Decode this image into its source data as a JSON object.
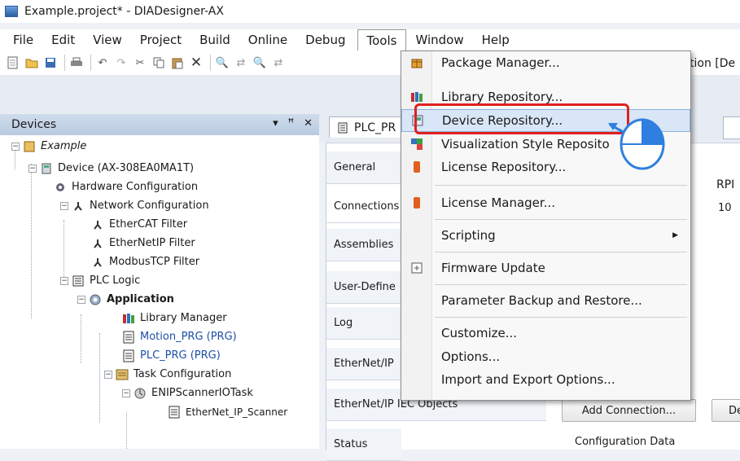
{
  "window": {
    "title": "Example.project* - DIADesigner-AX"
  },
  "menubar": {
    "items": [
      "File",
      "Edit",
      "View",
      "Project",
      "Build",
      "Online",
      "Debug",
      "Tools",
      "Window",
      "Help"
    ]
  },
  "toolbar": {
    "right_text": "tion [De"
  },
  "devices_panel": {
    "title": "Devices",
    "controls": {
      "dropdown": "▾",
      "pin": "ꟸ",
      "close": "✕"
    },
    "tree": [
      {
        "label": "Example"
      },
      {
        "label": "Device (AX-308EA0MA1T)"
      },
      {
        "label": "Hardware Configuration"
      },
      {
        "label": "Network Configuration"
      },
      {
        "label": "EtherCAT Filter"
      },
      {
        "label": "EtherNetIP Filter"
      },
      {
        "label": "ModbusTCP Filter"
      },
      {
        "label": "PLC Logic"
      },
      {
        "label": "Application"
      },
      {
        "label": "Library Manager"
      },
      {
        "label": "Motion_PRG (PRG)"
      },
      {
        "label": "PLC_PRG (PRG)"
      },
      {
        "label": "Task Configuration"
      },
      {
        "label": "ENIPScannerIOTask"
      },
      {
        "label": "EtherNet_IP_Scanner"
      }
    ]
  },
  "editor": {
    "tab_label": "PLC_PR",
    "side_tabs": [
      "General",
      "Connections",
      "Assemblies",
      "User-Define",
      "Log",
      "EtherNet/IP",
      "EtherNet/IP IEC Objects",
      "Status"
    ],
    "rpi_header": "RPI",
    "rpi_value": "10",
    "add_connection_button": "Add Connection...",
    "second_button": "De",
    "config_data_label": "Configuration Data"
  },
  "tools_menu": {
    "items": [
      {
        "label": "Package Manager...",
        "icon": "package-icon"
      },
      {
        "label": "Library Repository...",
        "icon": "books-icon"
      },
      {
        "label": "Device Repository...",
        "icon": "device-repo-icon",
        "highlighted": true
      },
      {
        "label": "Visualization Style Reposito",
        "icon": "vis-style-icon"
      },
      {
        "label": "License Repository...",
        "icon": "license-icon"
      },
      {
        "label": "License Manager...",
        "icon": "license-icon"
      },
      {
        "label": "Scripting",
        "icon": "none",
        "submenu": true
      },
      {
        "label": "Firmware Update",
        "icon": "firmware-icon"
      },
      {
        "label": "Parameter Backup and Restore...",
        "icon": "none"
      },
      {
        "label": "Customize...",
        "icon": "none"
      },
      {
        "label": "Options...",
        "icon": "none"
      },
      {
        "label": "Import and Export Options...",
        "icon": "none"
      }
    ]
  },
  "colors": {
    "highlight_box": "#e02020",
    "menu_highlight": "#d8e6f7",
    "panel_header": "#c4d4e8",
    "cursor_blue": "#2f7fe0"
  }
}
